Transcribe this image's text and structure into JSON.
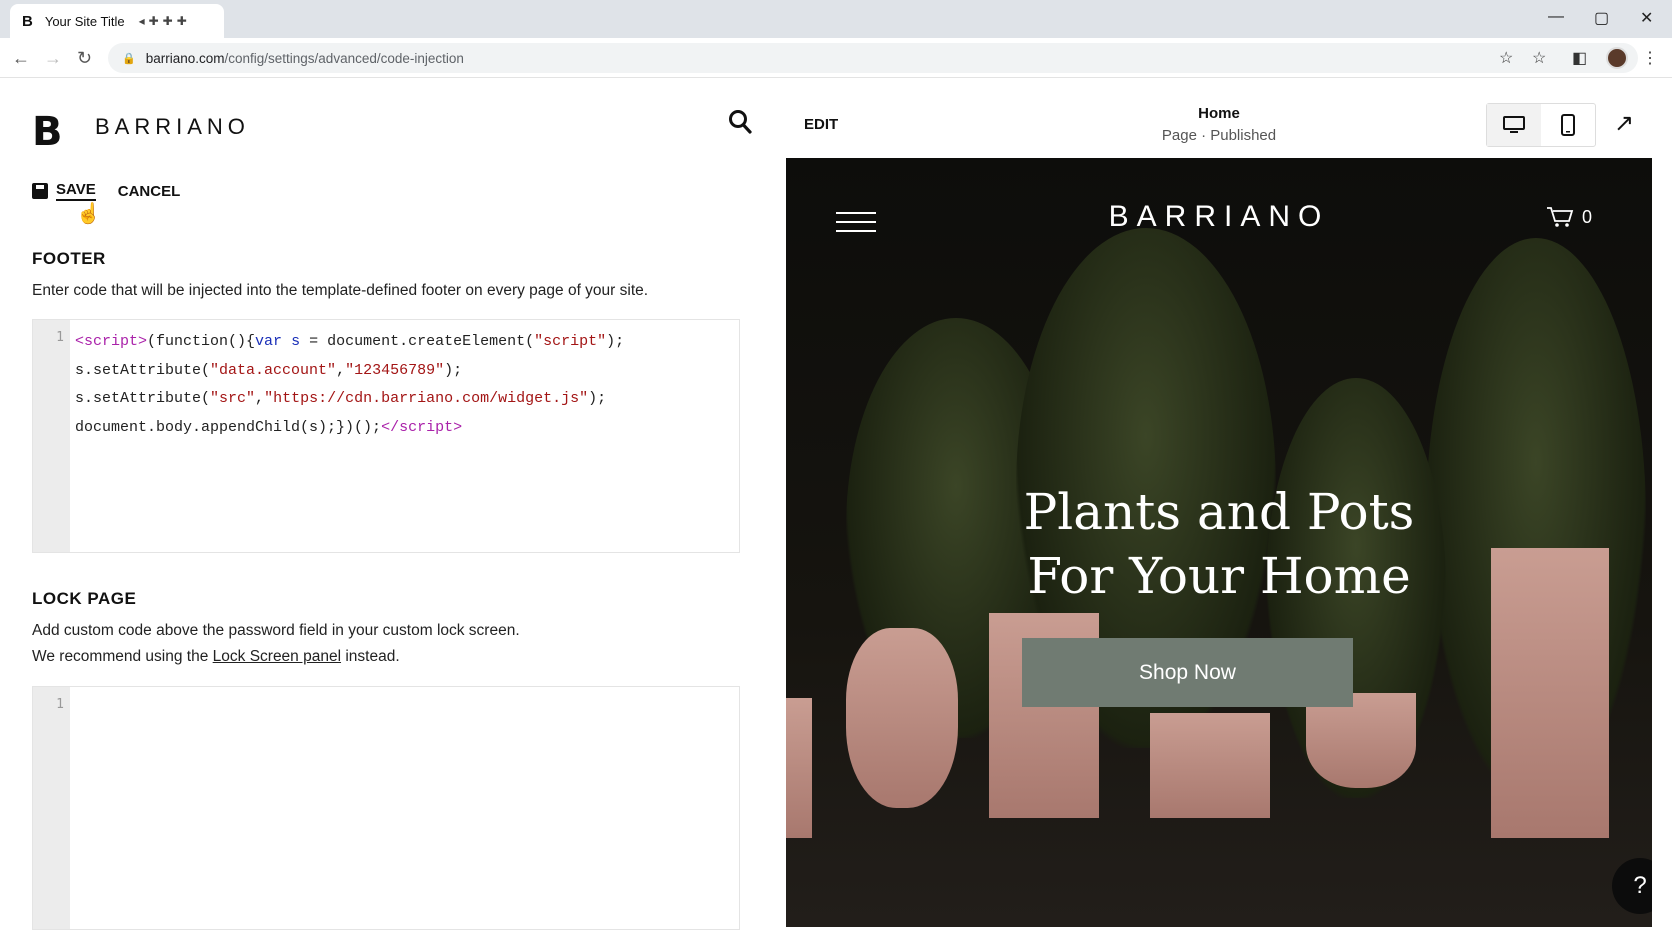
{
  "browser": {
    "tab_title": "Your Site Title",
    "tab_favicon": "B",
    "url_host": "barriano.com",
    "url_path": "/config/settings/advanced/code-injection"
  },
  "editor": {
    "logo_mark": "B",
    "logo_text": "BARRIANO",
    "save_label": "SAVE",
    "cancel_label": "CANCEL",
    "footer": {
      "title": "FOOTER",
      "description": "Enter code that will be injected into the template-defined footer on every page of your site.",
      "line_number": "1"
    },
    "lock_page": {
      "title": "LOCK PAGE",
      "description_1": "Add custom code above the password field in your custom lock screen.",
      "description_2_pre": "We recommend using the ",
      "description_2_link": "Lock Screen panel",
      "description_2_post": " instead.",
      "line_number": "1"
    }
  },
  "preview": {
    "edit_label": "EDIT",
    "page_title": "Home",
    "page_status": "Page · Published",
    "brand": "BARRIANO",
    "cart_count": "0",
    "headline_1": "Plants and Pots",
    "headline_2": "For Your Home",
    "cta_label": "Shop Now",
    "help_label": "?"
  }
}
